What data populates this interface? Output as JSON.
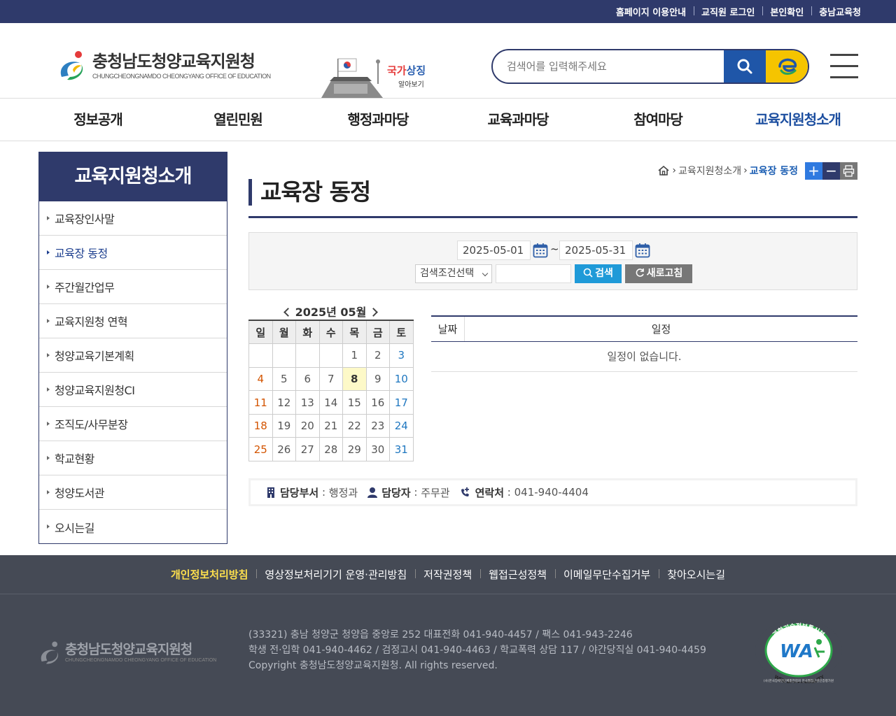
{
  "utility_links": [
    "홈페이지 이용안내",
    "교직원 로그인",
    "본인확인",
    "충남교육청"
  ],
  "logo": {
    "name_ko": "충청남도청양교육지원청",
    "name_en": "CHUNGCHEONGNAMDO CHEONGYANG OFFICE OF EDUCATION"
  },
  "banner": {
    "line1_red": "국가",
    "line1_blue": "상징",
    "line2": "알아보기"
  },
  "search": {
    "placeholder": "검색어를 입력해주세요"
  },
  "gnb": [
    "정보공개",
    "열린민원",
    "행정과마당",
    "교육과마당",
    "참여마당",
    "교육지원청소개"
  ],
  "gnb_active_index": 5,
  "lnb": {
    "title": "교육지원청소개",
    "items": [
      "교육장인사말",
      "교육장 동정",
      "주간월간업무",
      "교육지원청 연혁",
      "청양교육기본계획",
      "청양교육지원청CI",
      "조직도/사무분장",
      "학교현황",
      "청양도서관",
      "오시는길"
    ],
    "active_index": 1
  },
  "breadcrumb": {
    "parent": "교육지원청소개",
    "current": "교육장 동정"
  },
  "page_title": "교육장 동정",
  "filter": {
    "start_date": "2025-05-01",
    "end_date": "2025-05-31",
    "tilde": "~",
    "condition": "검색조건선택",
    "search_label": "검색",
    "reset_label": "새로고침"
  },
  "calendar": {
    "title": "2025년 05월",
    "weekdays": [
      "일",
      "월",
      "화",
      "수",
      "목",
      "금",
      "토"
    ],
    "weeks": [
      [
        "",
        "",
        "",
        "",
        "1",
        "2",
        "3"
      ],
      [
        "4",
        "5",
        "6",
        "7",
        "8",
        "9",
        "10"
      ],
      [
        "11",
        "12",
        "13",
        "14",
        "15",
        "16",
        "17"
      ],
      [
        "18",
        "19",
        "20",
        "21",
        "22",
        "23",
        "24"
      ],
      [
        "25",
        "26",
        "27",
        "28",
        "29",
        "30",
        "31"
      ]
    ],
    "today": "8"
  },
  "schedule": {
    "col_date": "날짜",
    "col_event": "일정",
    "empty_text": "일정이 없습니다."
  },
  "info": {
    "dept_label": "담당부서",
    "dept": "행정과",
    "person_label": "담당자",
    "person": "주무관",
    "contact_label": "연락처",
    "contact": "041-940-4404"
  },
  "footer": {
    "links": [
      "개인정보처리방침",
      "영상정보처리기기 운영·관리방침",
      "저작권정책",
      "웹접근성정책",
      "이메일무단수집거부",
      "찾아오시는길"
    ],
    "address_lines": [
      "(33321) 충남 청양군 청양읍 중앙로 252 대표전화 041-940-4457 / 팩스 041-943-2246",
      "학생 전·입학 041-940-4462 / 검정고시 041-940-4463 / 학교폭력 상담 117 / 야간당직실 041-940-4459",
      "Copyright 충청남도청양교육지원청. All rights reserved."
    ],
    "wa_top": "과학기술정보통신부",
    "wa_mark": "WA",
    "wa_text": "WEB ACCESSIBILITY",
    "wa_bottom": "(사)한국장애인단체총연합회 한국웹접근성인증평가원"
  },
  "colors": {
    "primary": "#2f3a6b",
    "accent_blue": "#1d4fa0",
    "search_btn": "#1f9ad8",
    "footer_bg": "#454a55"
  }
}
